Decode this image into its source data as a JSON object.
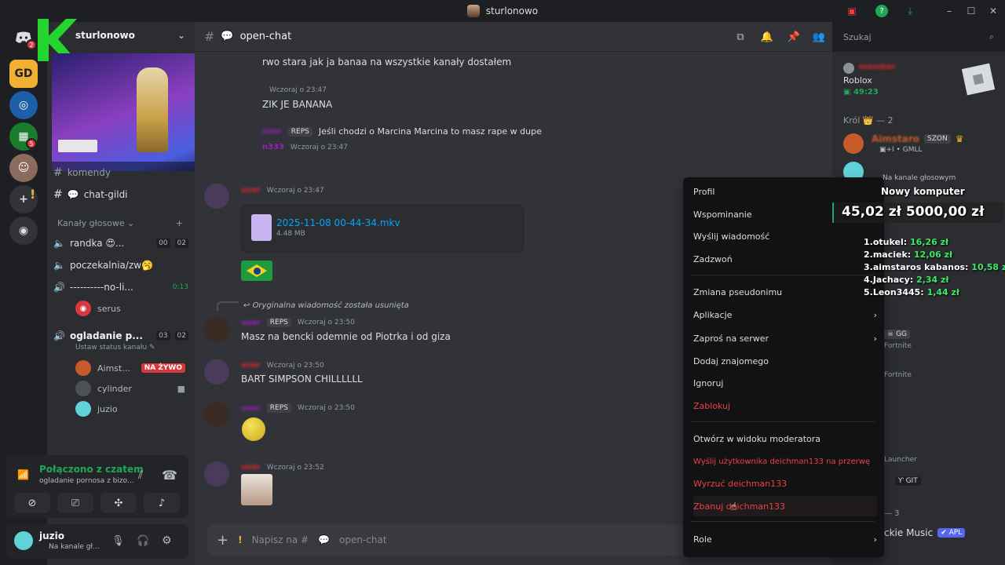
{
  "window": {
    "title": "sturlonowo",
    "controls": {
      "minimize": "–",
      "maximize": "☐",
      "close": "✕"
    }
  },
  "servers": {
    "home_badge": "2",
    "badge2": "5"
  },
  "sidebar": {
    "server_name": "sturlonowo",
    "text_channels": [
      {
        "label": "komendy"
      },
      {
        "label": "chat-gildi"
      }
    ],
    "voice_category": "Kanały głosowe",
    "voice_channels": [
      {
        "label": "randka 😍...",
        "count_a": "00",
        "count_b": "02"
      },
      {
        "label": "poczekalnia/zw🥱"
      },
      {
        "label": "----------no-li...",
        "timer": "0:13"
      },
      {
        "label": "ogladanie p...",
        "count_a": "03",
        "count_b": "02",
        "status_hint": "Ustaw status kanału"
      }
    ],
    "voice_users_ch3": [
      {
        "name": "serus"
      }
    ],
    "voice_users_ch4": [
      {
        "name": "Aimst...",
        "live": "NA ŻYWO"
      },
      {
        "name": "cylinder"
      },
      {
        "name": "juzio"
      }
    ]
  },
  "voice_status": {
    "title": "Połączono z czatem",
    "subtitle": "ogladanie pornosa z bizo..."
  },
  "user_panel": {
    "name": "juzio",
    "status": "Na kanale gł..."
  },
  "chat": {
    "channel_name": "open-chat",
    "composer_placeholder": "Napisz na #",
    "composer_channel": "open-chat",
    "messages": [
      {
        "text": "rwo stara jak ja banaa na wszystkie kanały dostałem"
      },
      {
        "time": "Wczoraj o 23:47",
        "text": "ZIK JE BANANA"
      },
      {
        "badge": "REPS",
        "text": "Jeśli chodzi o Marcina Marcina to masz rape w dupe"
      },
      {
        "author": "n333",
        "time": "Wczoraj o 23:47"
      },
      {
        "time": "Wczoraj o 23:47",
        "file_name": "2025-11-08 00-44-34.mkv",
        "file_size": "4.48 MB"
      },
      {
        "reply_note": "Oryginalna wiadomość została usunięta",
        "badge": "REPS",
        "time": "Wczoraj o 23:50",
        "text": "Masz na bencki odemnie od Piotrka i od giza"
      },
      {
        "time": "Wczoraj o 23:50",
        "text": "BART SIMPSON CHILLLLLL"
      },
      {
        "badge": "REPS",
        "time": "Wczoraj o 23:50"
      },
      {
        "time": "Wczoraj o 23:52"
      }
    ]
  },
  "search": {
    "placeholder": "Szukaj"
  },
  "members": {
    "activity_game": "Roblox",
    "activity_time": "49:23",
    "role_header": "Król 👑 — 2",
    "member1_name": "Aimstaro",
    "member1_tag": "SZON",
    "member1_status": "GMLL",
    "member2_sub": "Na kanale głosowym",
    "overlay_right": [
      {
        "tag": "GG",
        "game": "Fortnite"
      },
      {
        "game": "Fortnite"
      },
      {
        "text": "Launcher"
      },
      {
        "tag": "GIT"
      }
    ],
    "bottom_section": "— 3",
    "bottom_member": "ckie Music",
    "bottom_tag": "APL"
  },
  "overlay": {
    "goal_title": "Nowy komputer",
    "goal_current": "45,02 zł",
    "goal_target": "5000,00 zł",
    "leaderboard": [
      {
        "name": "1.otukel:",
        "amount": "16,26 zł"
      },
      {
        "name": "2.maciek:",
        "amount": "12,06 zł"
      },
      {
        "name": "3.aimstaros kabanos:",
        "amount": "10,58 zł"
      },
      {
        "name": "4.Jachacy:",
        "amount": "2,34 zł"
      },
      {
        "name": "5.Leon3445:",
        "amount": "1,44 zł"
      }
    ]
  },
  "context_menu": {
    "items": [
      {
        "label": "Profil"
      },
      {
        "label": "Wspominanie"
      },
      {
        "label": "Wyślij wiadomość"
      },
      {
        "label": "Zadzwoń"
      },
      {
        "label": "Zmiana pseudonimu"
      },
      {
        "label": "Aplikacje",
        "arrow": "›"
      },
      {
        "label": "Zaproś na serwer",
        "arrow": "›"
      },
      {
        "label": "Dodaj znajomego"
      },
      {
        "label": "Ignoruj"
      },
      {
        "label": "Zablokuj"
      },
      {
        "label": "Otwórz w widoku moderatora"
      },
      {
        "label": "Wyślij użytkownika deichman133 na przerwę"
      },
      {
        "label": "Wyrzuć deichman133"
      },
      {
        "label": "Zbanuj deichman133"
      },
      {
        "label": "Role",
        "arrow": "›"
      }
    ]
  },
  "colors": {
    "bg_dark": "#1e1f22",
    "bg_sidebar": "#2b2d31",
    "bg_chat": "#313338",
    "danger": "#f23f43",
    "online": "#23a55a",
    "blurple": "#5865f2"
  }
}
